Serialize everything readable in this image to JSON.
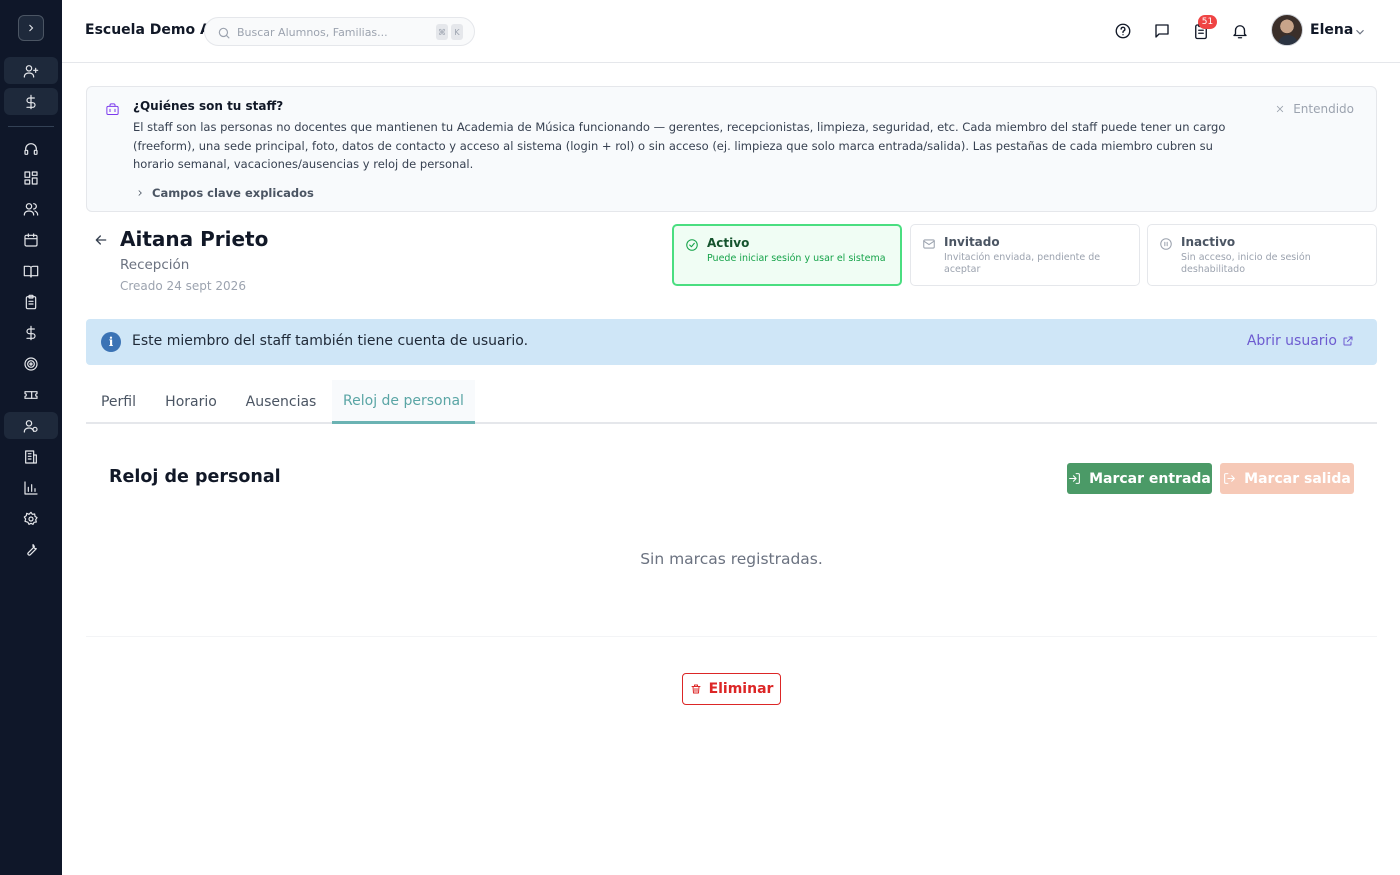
{
  "header": {
    "school_name": "Escuela Demo A",
    "search_placeholder": "Buscar Alumnos, Familias...",
    "search_kbd": [
      "⌘",
      "K"
    ],
    "notification_count": "51",
    "user_name": "Elena"
  },
  "sidebar": {
    "items": [
      {
        "icon": "user-plus-icon"
      },
      {
        "icon": "dollar-icon"
      },
      {
        "icon": "headset-icon"
      },
      {
        "icon": "dashboard-icon"
      },
      {
        "icon": "users-icon"
      },
      {
        "icon": "calendar-icon"
      },
      {
        "icon": "book-icon"
      },
      {
        "icon": "clipboard-icon"
      },
      {
        "icon": "dollar-icon"
      },
      {
        "icon": "target-icon"
      },
      {
        "icon": "ticket-icon"
      },
      {
        "icon": "staff-icon"
      },
      {
        "icon": "building-icon"
      },
      {
        "icon": "chart-icon"
      },
      {
        "icon": "gear-icon"
      },
      {
        "icon": "wrench-icon"
      }
    ]
  },
  "info": {
    "title": "¿Quiénes son tu staff?",
    "body": "El staff son las personas no docentes que mantienen tu Academia de Música funcionando — gerentes, recepcionistas, limpieza, seguridad, etc. Cada miembro del staff puede tener un cargo (freeform), una sede principal, foto, datos de contacto y acceso al sistema (login + rol) o sin acceso (ej. limpieza que solo marca entrada/salida). Las pestañas de cada miembro cubren su horario semanal, vacaciones/ausencias y reloj de personal.",
    "more_label": "Campos clave explicados",
    "dismiss_label": "Entendido"
  },
  "profile": {
    "name": "Aitana Prieto",
    "role": "Recepción",
    "created": "Creado 24 sept 2026"
  },
  "statuses": [
    {
      "title": "Activo",
      "desc": "Puede iniciar sesión y usar el sistema",
      "selected": true,
      "color": "#15803d"
    },
    {
      "title": "Invitado",
      "desc": "Invitación enviada, pendiente de aceptar",
      "selected": false,
      "color": "#9ca3af"
    },
    {
      "title": "Inactivo",
      "desc": "Sin acceso, inicio de sesión deshabilitado",
      "selected": false,
      "color": "#9ca3af"
    }
  ],
  "alert": {
    "text": "Este miembro del staff también tiene cuenta de usuario.",
    "link": "Abrir usuario"
  },
  "tabs": [
    {
      "label": "Perfil"
    },
    {
      "label": "Horario"
    },
    {
      "label": "Ausencias"
    },
    {
      "label": "Reloj de personal",
      "selected": true
    }
  ],
  "clock": {
    "title": "Reloj de personal",
    "clock_in_label": "Marcar entrada",
    "clock_out_label": "Marcar salida",
    "empty_text": "Sin marcas registradas."
  },
  "delete_label": "Eliminar",
  "colors": {
    "sidebar_bg": "#0f1729",
    "accent_teal": "#5aa5a5",
    "success": "#4b9a67",
    "danger": "#dc2626",
    "link": "#6d5bd0"
  }
}
